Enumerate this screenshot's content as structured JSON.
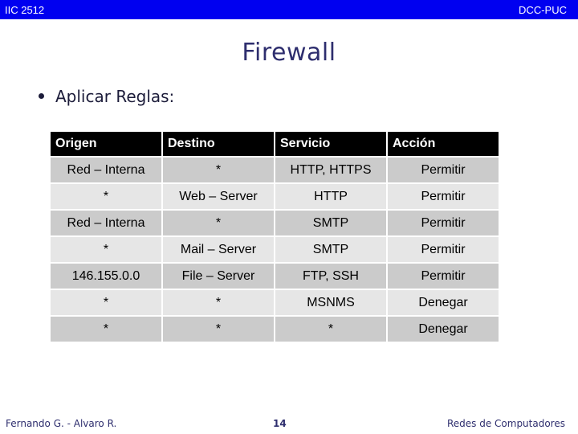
{
  "header": {
    "course_code": "IIC 2512",
    "institution": "DCC-PUC"
  },
  "slide": {
    "title": "Firewall",
    "bullet": "Aplicar Reglas:"
  },
  "table": {
    "columns": [
      "Origen",
      "Destino",
      "Servicio",
      "Acción"
    ],
    "rows": [
      [
        "Red – Interna",
        "*",
        "HTTP, HTTPS",
        "Permitir"
      ],
      [
        "*",
        "Web – Server",
        "HTTP",
        "Permitir"
      ],
      [
        "Red – Interna",
        "*",
        "SMTP",
        "Permitir"
      ],
      [
        "*",
        "Mail – Server",
        "SMTP",
        "Permitir"
      ],
      [
        "146.155.0.0",
        "File – Server",
        "FTP, SSH",
        "Permitir"
      ],
      [
        "*",
        "*",
        "MSNMS",
        "Denegar"
      ],
      [
        "*",
        "*",
        "*",
        "Denegar"
      ]
    ]
  },
  "footer": {
    "authors": "Fernando G. - Alvaro R.",
    "page_number": "14",
    "course_name": "Redes de Computadores"
  },
  "colors": {
    "header_bar": "#0000f0",
    "title_text": "#2e2e6e",
    "table_header_bg": "#000000",
    "row_dark_bg": "#cbcbcb",
    "row_light_bg": "#e6e6e6"
  }
}
